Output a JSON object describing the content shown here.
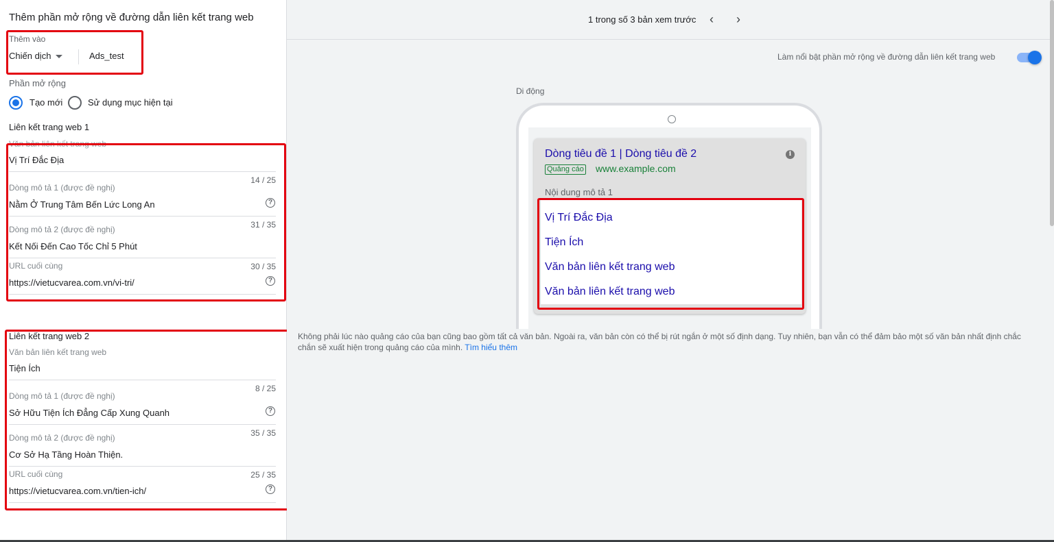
{
  "panel": {
    "title": "Thêm phần mở rộng về đường dẫn liên kết trang web",
    "add_to_label": "Thêm vào",
    "level_value": "Chiến dịch",
    "campaign_name": "Ads_test",
    "extension_label": "Phần mở rộng",
    "radio_new": "Tạo mới",
    "radio_existing": "Sử dụng mục hiện tại"
  },
  "sitelinks": [
    {
      "heading": "Liên kết trang web 1",
      "text_label": "Văn bản liên kết trang web",
      "text_value": "Vị Trí Đắc Địa",
      "text_counter": "14 / 25",
      "desc1_label": "Dòng mô tả 1 (được đề nghị)",
      "desc1_value": "Nằm Ở Trung Tâm Bến Lức Long An",
      "desc1_counter": "31 / 35",
      "desc2_label": "Dòng mô tả 2 (được đề nghị)",
      "desc2_value": "Kết Nối Đến Cao Tốc Chỉ 5 Phút",
      "desc2_counter": "30 / 35",
      "url_label": "URL cuối cùng",
      "url_value": "https://vietucvarea.com.vn/vi-tri/"
    },
    {
      "heading": "Liên kết trang web 2",
      "text_label": "Văn bản liên kết trang web",
      "text_value": "Tiện Ích",
      "text_counter": "8 / 25",
      "desc1_label": "Dòng mô tả 1 (được đề nghị)",
      "desc1_value": "Sở Hữu Tiện Ích Đẳng Cấp Xung Quanh",
      "desc1_counter": "35 / 35",
      "desc2_label": "Dòng mô tả 2 (được đề nghị)",
      "desc2_value": "Cơ Sở Hạ Tầng Hoàn Thiện.",
      "desc2_counter": "25 / 35",
      "url_label": "URL cuối cùng",
      "url_value": "https://vietucvarea.com.vn/tien-ich/"
    }
  ],
  "preview": {
    "pager": "1 trong số 3 bản xem trước",
    "prev_icon": "chevron-left-icon",
    "next_icon": "chevron-right-icon",
    "highlight_toggle_label": "Làm nổi bật phần mở rộng về đường dẫn liên kết trang web",
    "highlight_toggle_on": true,
    "device_label": "Di động",
    "ad": {
      "headline": "Dòng tiêu đề 1 | Dòng tiêu đề 2",
      "badge": "Quảng cáo",
      "display_url": "www.example.com",
      "description": "Nội dung mô tả 1",
      "sitelinks": [
        "Vị Trí Đắc Địa",
        "Tiện Ích",
        "Văn bản liên kết trang web",
        "Văn bản liên kết trang web"
      ]
    },
    "note": "Không phải lúc nào quảng cáo của bạn cũng bao gồm tất cả văn bản. Ngoài ra, văn bản còn có thể bị rút ngắn ở một số định dạng. Tuy nhiên, bạn vẫn có thể đảm bảo một số văn bản nhất định chắc chắn sẽ xuất hiện trong quảng cáo của mình.",
    "learn_more": "Tìm hiểu thêm"
  },
  "colors": {
    "accent": "#1a73e8",
    "highlight_box": "#e3000f",
    "ad_link": "#1a0dab",
    "ad_url": "#188038"
  }
}
